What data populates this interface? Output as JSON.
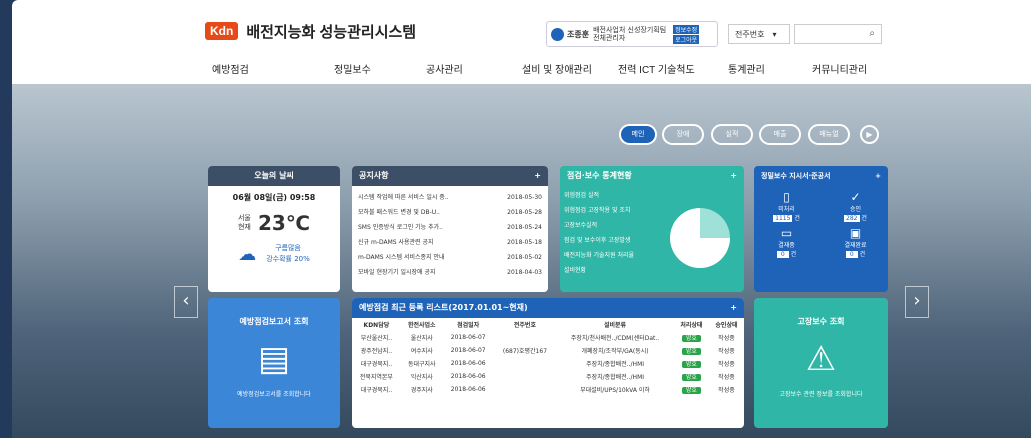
{
  "header": {
    "logo": "Kdn",
    "title": "배전지능화 성능관리시스템",
    "user": "조종훈",
    "org": "배전사업처 신성장기획팀 전체관리자",
    "btn_info": "정보수정",
    "btn_logout": "로그아웃",
    "pole_select": "전주번호",
    "search_icon": "search-icon"
  },
  "nav": [
    "예방점검",
    "정밀보수",
    "공사관리",
    "설비 및 장애관리",
    "전력 ICT 기술척도",
    "통계관리",
    "커뮤니티관리"
  ],
  "pills": [
    "메인",
    "장애",
    "실적",
    "매출",
    "매뉴얼"
  ],
  "weather": {
    "title": "오늘의 날씨",
    "date": "06월 08일(금) 09:58",
    "place": "서울 현재",
    "temp": "23℃",
    "sky": "구름많음",
    "rain": "강수확률 20%"
  },
  "notice": {
    "title": "공지사항",
    "items": [
      {
        "t": "시스템 작업에 따른 서비스 일시 중..",
        "d": "2018-05-30"
      },
      {
        "t": "모하블 패스워드 변경 및 DB-U..",
        "d": "2018-05-28"
      },
      {
        "t": "SMS 인증방식 로그인 기능 추가..",
        "d": "2018-05-24"
      },
      {
        "t": "신규 m-DAMS 사용관련 공지",
        "d": "2018-05-18"
      },
      {
        "t": "m-DAMS 시스템 서비스종지 안내",
        "d": "2018-05-02"
      },
      {
        "t": "모바일 현장기기 일시장애 공지",
        "d": "2018-04-03"
      }
    ]
  },
  "stats": {
    "title": "점검·보수 통계현황",
    "items": [
      "위험점검 실적",
      "위험점검 고장착용 및 조치",
      "고장보수실적",
      "점검 및 보수이후 고장발생",
      "배전지능화 기술지원 처리율",
      "설비현황"
    ]
  },
  "precise": {
    "title": "정밀보수 지시서·준공서",
    "a": "미처리",
    "a_v": "1115",
    "b": "승인",
    "b_v": "282",
    "c": "결재중",
    "c_v": "0",
    "d": "결재완료",
    "d_v": "0",
    "unit": "건"
  },
  "report": {
    "title": "예방점검보고서 조회",
    "desc": "예방점검보고서를 조회합니다"
  },
  "list": {
    "title": "예방점검 최근 등록 리스트(2017.01.01~현재)",
    "cols": [
      "KDN담당",
      "한전사업소",
      "점검일자",
      "전주번호",
      "설비분류",
      "처리상태",
      "승인상태"
    ],
    "rows": [
      [
        "부산울산지..",
        "울산지사",
        "2018-06-07",
        "",
        "주장치/천사배전../CDM(센터Dat..",
        "양호",
        "작성중"
      ],
      [
        "광주전남지..",
        "여수지사",
        "2018-06-07",
        "(687)호평간167",
        "개폐장치/조작부/GA(동시)",
        "양호",
        "작성중"
      ],
      [
        "대구경북지..",
        "동대구지사",
        "2018-06-06",
        "",
        "주장치/종합배전../HMI",
        "양호",
        "작성중"
      ],
      [
        "전북지역본부",
        "익산지사",
        "2018-06-06",
        "",
        "주장치/종합배전../HMI",
        "양호",
        "작성중"
      ],
      [
        "대구경북지..",
        "경주지사",
        "2018-06-06",
        "",
        "부대설비/UPS/10kVA 이하",
        "양호",
        "작성중"
      ]
    ]
  },
  "fault": {
    "title": "고장보수 조회",
    "desc": "고장보수 관련 정보를 조회합니다"
  }
}
